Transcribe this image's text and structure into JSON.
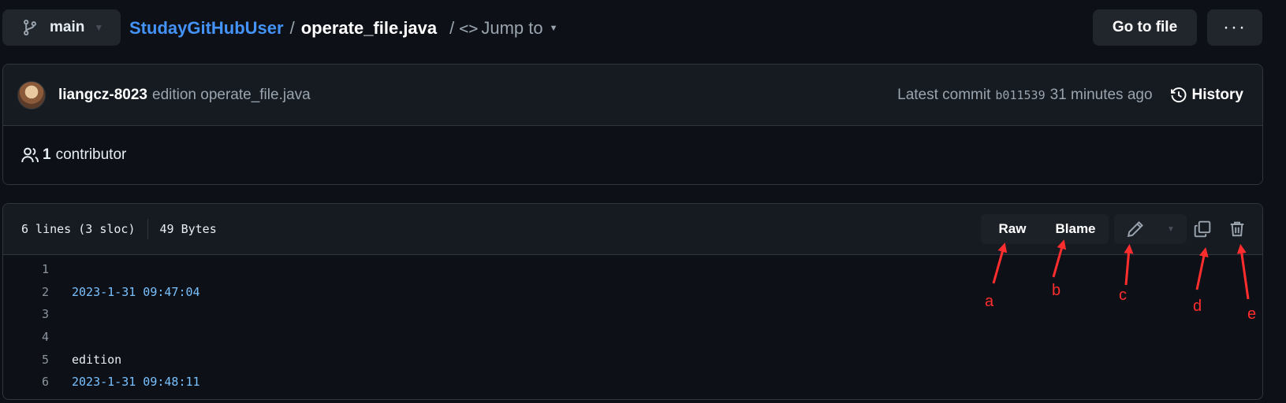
{
  "topbar": {
    "branch_label": "main",
    "repo": "StudayGitHubUser",
    "separator": "/",
    "file_name": "operate_file.java",
    "jump_separator": "/",
    "jump_label": "Jump to",
    "goto_label": "Go to file",
    "more_label": "···"
  },
  "commit": {
    "author": "liangcz-8023",
    "message": "edition operate_file.java",
    "latest_label": "Latest commit",
    "sha": "b011539",
    "time": "31 minutes ago",
    "history_label": "History"
  },
  "contributors": {
    "count": "1",
    "label": "contributor"
  },
  "file": {
    "lines_info": "6 lines (3 sloc)",
    "size": "49 Bytes",
    "raw_label": "Raw",
    "blame_label": "Blame",
    "lines": [
      {
        "num": "1",
        "text": ""
      },
      {
        "num": "2",
        "text": "2023-1-31 09:47:04"
      },
      {
        "num": "3",
        "text": ""
      },
      {
        "num": "4",
        "text": ""
      },
      {
        "num": "5",
        "text": "edition"
      },
      {
        "num": "6",
        "text": "2023-1-31 09:48:11"
      }
    ]
  },
  "annotations": {
    "a": "a",
    "b": "b",
    "c": "c",
    "d": "d",
    "e": "e",
    "color": "#ff2d2d"
  },
  "colors": {
    "background": "#0d1117",
    "link": "#4493f8",
    "number_text": "#79c0ff"
  }
}
